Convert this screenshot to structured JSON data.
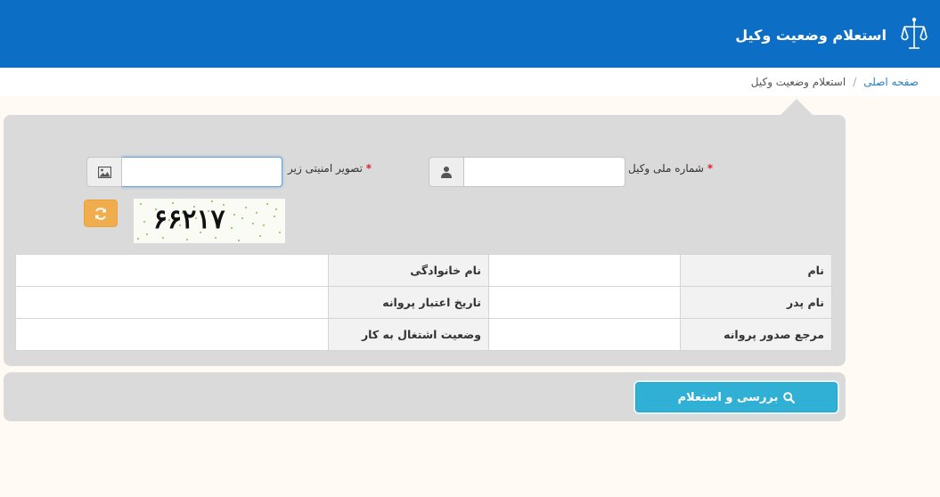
{
  "header": {
    "title": "استعلام وضعیت وکیل",
    "logo_icon": "iran-emblem-icon",
    "bg_color": "#0c6ec4"
  },
  "breadcrumb": {
    "home": "صفحه اصلی",
    "separator": "/",
    "current": "استعلام وضعیت وکیل"
  },
  "form": {
    "national_id": {
      "label": "شماره ملی وکیل",
      "required_mark": "*",
      "value": "",
      "icon": "user-icon"
    },
    "captcha_input": {
      "label": "تصویر امنیتی زیر",
      "required_mark": "*",
      "value": "",
      "icon": "image-icon"
    },
    "captcha": {
      "text": "۶۶۲۱۷",
      "refresh_icon": "refresh-icon"
    }
  },
  "info_table": {
    "rows": [
      [
        {
          "key": "نام",
          "value": ""
        },
        {
          "key": "نام خانوادگی",
          "value": ""
        }
      ],
      [
        {
          "key": "نام پدر",
          "value": ""
        },
        {
          "key": "تاریخ اعتبار پروانه",
          "value": ""
        }
      ],
      [
        {
          "key": "مرجع صدور پروانه",
          "value": ""
        },
        {
          "key": "وضعیت اشتغال به کار",
          "value": ""
        }
      ]
    ]
  },
  "actions": {
    "search_label": "بررسی و استعلام",
    "search_icon": "search-icon",
    "accent_color": "#31b0d5"
  }
}
